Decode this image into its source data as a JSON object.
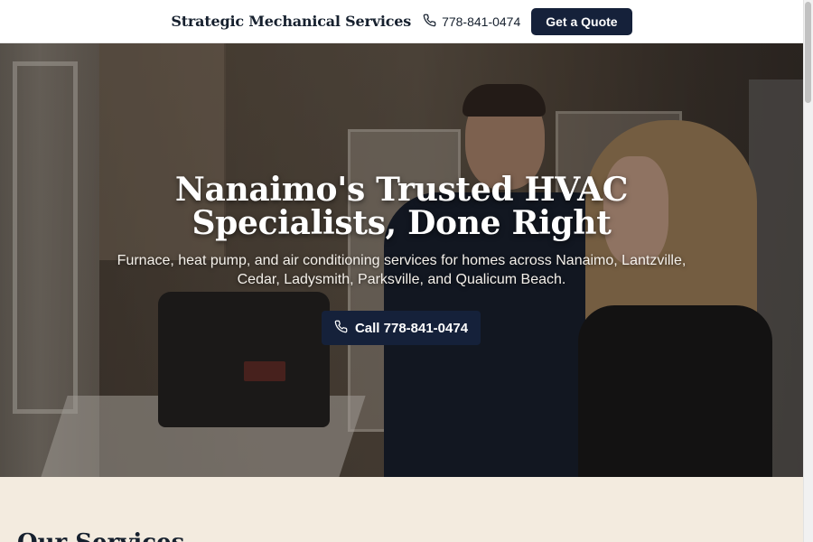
{
  "header": {
    "brand": "Strategic Mechanical Services",
    "phone": "778-841-0474",
    "quote_label": "Get a Quote"
  },
  "hero": {
    "title": "Nanaimo's Trusted HVAC Specialists, Done Right",
    "subtitle": "Furnace, heat pump, and air conditioning services for homes across Nanaimo, Lantzville, Cedar, Ladysmith, Parksville, and Qualicum Beach.",
    "call_label": "Call 778-841-0474",
    "background": "hvac-technician-kitchen-photo"
  },
  "services": {
    "heading": "Our Services"
  },
  "icons": {
    "phone": "phone-icon"
  },
  "colors": {
    "navy": "#15213a",
    "cream": "#f3ebdf",
    "text_dark": "#16202e"
  }
}
